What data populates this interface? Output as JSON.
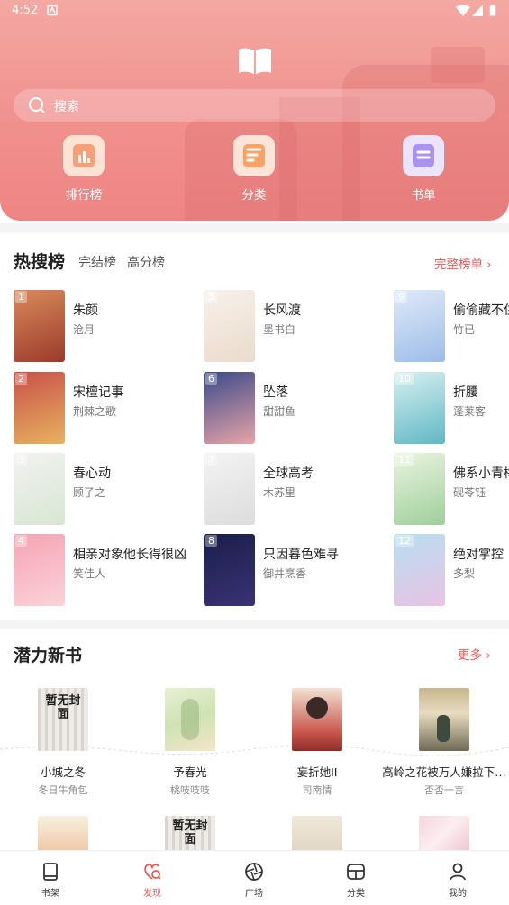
{
  "status": {
    "time": "4:52"
  },
  "header": {
    "search_placeholder": "搜索"
  },
  "quick": [
    {
      "label": "排行榜",
      "icon": "chart-icon"
    },
    {
      "label": "分类",
      "icon": "category-icon"
    },
    {
      "label": "书单",
      "icon": "booklist-icon"
    }
  ],
  "hot": {
    "title": "热搜榜",
    "tabs": [
      "完结榜",
      "高分榜"
    ],
    "more": "完整榜单 ›",
    "items": [
      {
        "num": "1",
        "title": "朱颜",
        "author": "沧月",
        "colors": [
          "#d98a5c",
          "#9c3a2a"
        ]
      },
      {
        "num": "2",
        "title": "宋檀记事",
        "author": "荆棘之歌",
        "colors": [
          "#c9504a",
          "#e6b35e"
        ]
      },
      {
        "num": "3",
        "title": "春心动",
        "author": "顾了之",
        "colors": [
          "#f2f2f0",
          "#d7e6d2"
        ]
      },
      {
        "num": "4",
        "title": "相亲对象他长得很凶",
        "author": "笑佳人",
        "colors": [
          "#f6a4b4",
          "#fbd2d8"
        ]
      },
      {
        "num": "5",
        "title": "长风渡",
        "author": "墨书白",
        "colors": [
          "#f7f1ea",
          "#eadbcc"
        ]
      },
      {
        "num": "6",
        "title": "坠落",
        "author": "甜甜鱼",
        "colors": [
          "#3c4a8a",
          "#e7a4a8"
        ]
      },
      {
        "num": "7",
        "title": "全球高考",
        "author": "木苏里",
        "colors": [
          "#f3f3f3",
          "#dcdcdc"
        ]
      },
      {
        "num": "8",
        "title": "只因暮色难寻",
        "author": "御井烹香",
        "colors": [
          "#1a1f4a",
          "#3a3275"
        ]
      },
      {
        "num": "9",
        "title": "偷偷藏不住",
        "author": "竹已",
        "colors": [
          "#dfeaf8",
          "#9cbde8"
        ]
      },
      {
        "num": "10",
        "title": "折腰",
        "author": "蓬莱客",
        "colors": [
          "#d8f0f0",
          "#5fb8c4"
        ]
      },
      {
        "num": "11",
        "title": "佛系小青梅",
        "author": "砚苓钰",
        "colors": [
          "#eaf4e0",
          "#9fcf9a"
        ]
      },
      {
        "num": "12",
        "title": "绝对掌控",
        "author": "多梨",
        "colors": [
          "#b8dff0",
          "#e9c2e4"
        ]
      }
    ]
  },
  "newbooks": {
    "title": "潜力新书",
    "more": "更多 ›",
    "items": [
      {
        "title": "小城之冬",
        "author": "冬日牛角包",
        "cover": "暂无封面"
      },
      {
        "title": "予春光",
        "author": "桃吱吱吱",
        "cover": ""
      },
      {
        "title": "妄折她II",
        "author": "司南情",
        "cover": ""
      },
      {
        "title": "高岭之花被万人嫌拉下…",
        "author": "否否一言",
        "cover": ""
      }
    ],
    "row2": [
      {
        "cover": "暂无封面"
      }
    ]
  },
  "tabbar": [
    {
      "label": "书架",
      "active": false
    },
    {
      "label": "发现",
      "active": true
    },
    {
      "label": "广场",
      "active": false
    },
    {
      "label": "分类",
      "active": false
    },
    {
      "label": "我的",
      "active": false
    }
  ],
  "colors": {
    "accent": "#e85a56",
    "hero_top": "#f4a8a2",
    "hero_bottom": "#ee8585"
  }
}
